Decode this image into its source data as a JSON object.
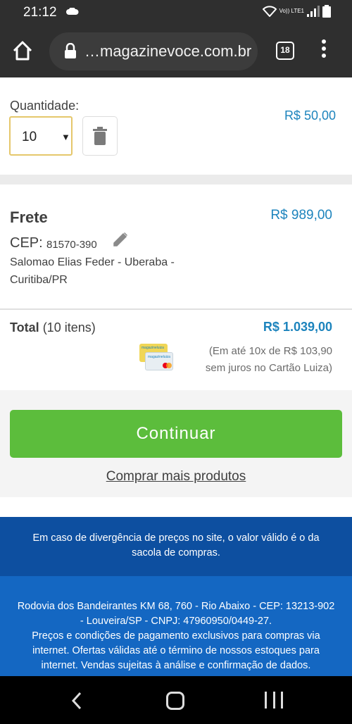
{
  "status_bar": {
    "time": "21:12",
    "network_label": "Vo)) LTE1"
  },
  "browser": {
    "url": "magazinevoce.com.br",
    "url_prefix": "…",
    "tab_count": "18"
  },
  "cart_item": {
    "quantity_label": "Quantidade:",
    "quantity_value": "10",
    "price": "R$ 50,00"
  },
  "shipping": {
    "title": "Frete",
    "price": "R$ 989,00",
    "cep_label": "CEP:",
    "cep_value": "81570-390",
    "address_line1": "Salomao Elias Feder - Uberaba -",
    "address_line2": "Curitiba/PR"
  },
  "total": {
    "label": "Total",
    "items": "(10 itens)",
    "price": "R$ 1.039,00",
    "installment_line1": "(Em até 10x de R$ 103,90",
    "installment_line2": "sem juros no Cartão Luiza)",
    "card_brand": "magazineluiza"
  },
  "actions": {
    "continue_label": "Continuar",
    "more_products_label": "Comprar mais produtos"
  },
  "footer": {
    "notice": "Em caso de divergência de preços no site, o valor válido é o da sacola de compras.",
    "address": "Rodovia dos Bandeirantes KM 68, 760 - Rio Abaixo - CEP: 13213-902 - Louveira/SP - CNPJ: 47960950/0449-27.",
    "terms": "Preços e condições de pagamento exclusivos para compras via internet. Ofertas válidas até o término de nossos estoques para internet. Vendas sujeitas à análise e confirmação de dados."
  },
  "colors": {
    "accent_blue": "#1d84bd",
    "continue_green": "#5cbd3c",
    "footer_dark": "#0d4fa0",
    "footer_light": "#1467c2"
  }
}
